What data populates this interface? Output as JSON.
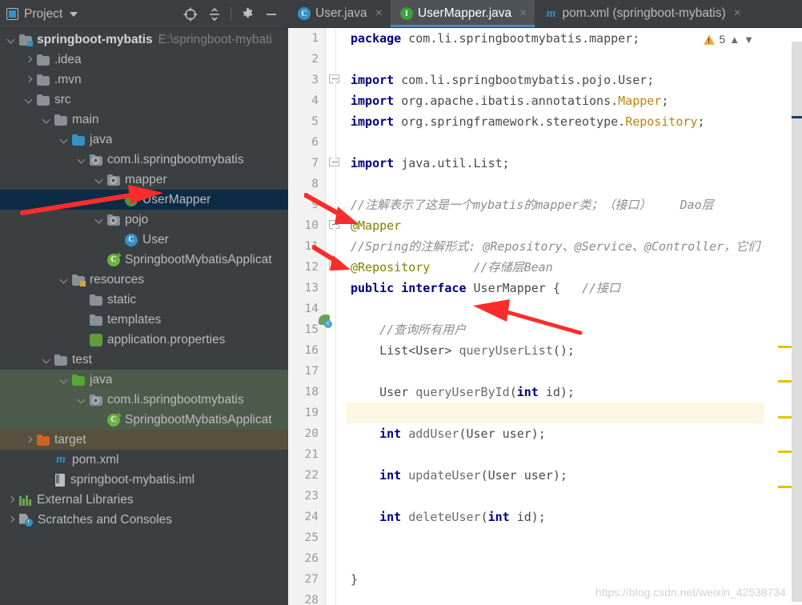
{
  "tool_window": {
    "title": "Project",
    "dropdown_icon": "chevron-down-icon",
    "actions": [
      {
        "name": "select-opened-file-icon",
        "label": "Select Opened File"
      },
      {
        "name": "collapse-all-icon",
        "label": "Collapse All"
      },
      {
        "name": "settings-gear-icon",
        "label": "Settings"
      },
      {
        "name": "hide-icon",
        "label": "Hide"
      }
    ]
  },
  "tree": [
    {
      "label": "springboot-mybatis",
      "path": "E:\\springboot-mybati",
      "icon": "module-folder-icon",
      "indent": 0,
      "arrow": "down",
      "bold": true,
      "state": "normal"
    },
    {
      "label": ".idea",
      "path": "",
      "icon": "folder-icon",
      "indent": 1,
      "arrow": "right",
      "bold": false,
      "state": "normal"
    },
    {
      "label": ".mvn",
      "path": "",
      "icon": "folder-icon",
      "indent": 1,
      "arrow": "right",
      "bold": false,
      "state": "normal"
    },
    {
      "label": "src",
      "path": "",
      "icon": "folder-icon",
      "indent": 1,
      "arrow": "down",
      "bold": false,
      "state": "normal"
    },
    {
      "label": "main",
      "path": "",
      "icon": "folder-icon",
      "indent": 2,
      "arrow": "down",
      "bold": false,
      "state": "normal"
    },
    {
      "label": "java",
      "path": "",
      "icon": "source-root-folder-icon",
      "indent": 3,
      "arrow": "down",
      "bold": false,
      "state": "normal"
    },
    {
      "label": "com.li.springbootmybatis",
      "path": "",
      "icon": "package-icon",
      "indent": 4,
      "arrow": "down",
      "bold": false,
      "state": "normal"
    },
    {
      "label": "mapper",
      "path": "",
      "icon": "package-icon",
      "indent": 5,
      "arrow": "down",
      "bold": false,
      "state": "normal"
    },
    {
      "label": "UserMapper",
      "path": "",
      "icon": "interface-icon",
      "indent": 6,
      "arrow": "none",
      "bold": false,
      "state": "selected"
    },
    {
      "label": "pojo",
      "path": "",
      "icon": "package-icon",
      "indent": 5,
      "arrow": "down",
      "bold": false,
      "state": "normal"
    },
    {
      "label": "User",
      "path": "",
      "icon": "class-icon",
      "indent": 6,
      "arrow": "none",
      "bold": false,
      "state": "normal"
    },
    {
      "label": "SpringbootMybatisApplicat",
      "path": "",
      "icon": "spring-boot-class-icon",
      "indent": 5,
      "arrow": "none",
      "bold": false,
      "state": "normal"
    },
    {
      "label": "resources",
      "path": "",
      "icon": "resources-root-folder-icon",
      "indent": 3,
      "arrow": "down",
      "bold": false,
      "state": "normal"
    },
    {
      "label": "static",
      "path": "",
      "icon": "folder-icon",
      "indent": 4,
      "arrow": "none",
      "bold": false,
      "state": "normal"
    },
    {
      "label": "templates",
      "path": "",
      "icon": "folder-icon",
      "indent": 4,
      "arrow": "none",
      "bold": false,
      "state": "normal"
    },
    {
      "label": "application.properties",
      "path": "",
      "icon": "spring-properties-icon",
      "indent": 4,
      "arrow": "none",
      "bold": false,
      "state": "normal"
    },
    {
      "label": "test",
      "path": "",
      "icon": "folder-icon",
      "indent": 2,
      "arrow": "down",
      "bold": false,
      "state": "normal"
    },
    {
      "label": "java",
      "path": "",
      "icon": "test-source-root-folder-icon",
      "indent": 3,
      "arrow": "down",
      "bold": false,
      "state": "test-scope"
    },
    {
      "label": "com.li.springbootmybatis",
      "path": "",
      "icon": "package-icon",
      "indent": 4,
      "arrow": "down",
      "bold": false,
      "state": "test-scope"
    },
    {
      "label": "SpringbootMybatisApplicat",
      "path": "",
      "icon": "spring-boot-class-icon",
      "indent": 5,
      "arrow": "none",
      "bold": false,
      "state": "test-scope"
    },
    {
      "label": "target",
      "path": "",
      "icon": "excluded-folder-icon",
      "indent": 1,
      "arrow": "right",
      "bold": false,
      "state": "excluded"
    },
    {
      "label": "pom.xml",
      "path": "",
      "icon": "maven-icon",
      "indent": 2,
      "arrow": "none",
      "bold": false,
      "state": "normal"
    },
    {
      "label": "springboot-mybatis.iml",
      "path": "",
      "icon": "iml-module-icon",
      "indent": 2,
      "arrow": "none",
      "bold": false,
      "state": "normal"
    },
    {
      "label": "External Libraries",
      "path": "",
      "icon": "libraries-icon",
      "indent": 0,
      "arrow": "right",
      "bold": false,
      "state": "normal"
    },
    {
      "label": "Scratches and Consoles",
      "path": "",
      "icon": "scratches-icon",
      "indent": 0,
      "arrow": "right",
      "bold": false,
      "state": "normal"
    }
  ],
  "tabs": [
    {
      "label": "User.java",
      "icon": "class-icon",
      "active": false,
      "close_icon": "close-icon"
    },
    {
      "label": "UserMapper.java",
      "icon": "interface-icon",
      "active": true,
      "close_icon": "close-icon"
    },
    {
      "label": "pom.xml (springboot-mybatis)",
      "icon": "maven-icon",
      "active": false,
      "close_icon": "close-icon"
    }
  ],
  "inspection": {
    "warning_icon": "warning-triangle-icon",
    "warning_count": "5",
    "prev_icon": "chevron-up-icon",
    "next_icon": "chevron-down-icon"
  },
  "code": {
    "language": "Java",
    "highlighted_line": 19,
    "total_visible_lines": 28,
    "lines": [
      {
        "n": 1,
        "tokens": [
          {
            "t": "package ",
            "c": "kw"
          },
          {
            "t": "com.li.springbootmybatis.mapper;",
            "c": "plain"
          }
        ]
      },
      {
        "n": 2,
        "tokens": []
      },
      {
        "n": 3,
        "tokens": [
          {
            "t": "import ",
            "c": "kw"
          },
          {
            "t": "com.li.springbootmybatis.pojo.User;",
            "c": "plain"
          }
        ]
      },
      {
        "n": 4,
        "tokens": [
          {
            "t": "import ",
            "c": "kw"
          },
          {
            "t": "org.apache.ibatis.annotations.",
            "c": "plain"
          },
          {
            "t": "Mapper",
            "c": "annref"
          },
          {
            "t": ";",
            "c": "plain"
          }
        ]
      },
      {
        "n": 5,
        "tokens": [
          {
            "t": "import ",
            "c": "kw"
          },
          {
            "t": "org.springframework.stereotype.",
            "c": "plain"
          },
          {
            "t": "Repository",
            "c": "annref"
          },
          {
            "t": ";",
            "c": "plain"
          }
        ]
      },
      {
        "n": 6,
        "tokens": []
      },
      {
        "n": 7,
        "tokens": [
          {
            "t": "import ",
            "c": "kw"
          },
          {
            "t": "java.util.List;",
            "c": "plain"
          }
        ]
      },
      {
        "n": 8,
        "tokens": []
      },
      {
        "n": 9,
        "tokens": [
          {
            "t": "//注解表示了这是一个mybatis的mapper类；（接口）    Dao层",
            "c": "cmt"
          }
        ]
      },
      {
        "n": 10,
        "tokens": [
          {
            "t": "@Mapper",
            "c": "anno"
          }
        ]
      },
      {
        "n": 11,
        "tokens": [
          {
            "t": "//Spring的注解形式: @Repository、@Service、@Controller，它们",
            "c": "cmt"
          }
        ]
      },
      {
        "n": 12,
        "tokens": [
          {
            "t": "@Repository",
            "c": "anno"
          },
          {
            "t": "      ",
            "c": "plain"
          },
          {
            "t": "//存储层Bean",
            "c": "cmt"
          }
        ]
      },
      {
        "n": 13,
        "tokens": [
          {
            "t": "public interface ",
            "c": "kw"
          },
          {
            "t": "UserMapper",
            "c": "plain"
          },
          {
            "t": " {   ",
            "c": "plain"
          },
          {
            "t": "//接口",
            "c": "cmt"
          }
        ]
      },
      {
        "n": 14,
        "tokens": []
      },
      {
        "n": 15,
        "tokens": [
          {
            "t": "    //查询所有用户",
            "c": "cmt"
          }
        ]
      },
      {
        "n": 16,
        "tokens": [
          {
            "t": "    ",
            "c": "plain"
          },
          {
            "t": "List<User>",
            "c": "plain"
          },
          {
            "t": " ",
            "c": "plain"
          },
          {
            "t": "queryUserList",
            "c": "ident"
          },
          {
            "t": "();",
            "c": "plain"
          }
        ]
      },
      {
        "n": 17,
        "tokens": []
      },
      {
        "n": 18,
        "tokens": [
          {
            "t": "    ",
            "c": "plain"
          },
          {
            "t": "User",
            "c": "plain"
          },
          {
            "t": " ",
            "c": "plain"
          },
          {
            "t": "queryUserById",
            "c": "ident"
          },
          {
            "t": "(",
            "c": "plain"
          },
          {
            "t": "int",
            "c": "kw"
          },
          {
            "t": " id);",
            "c": "plain"
          }
        ]
      },
      {
        "n": 19,
        "tokens": []
      },
      {
        "n": 20,
        "tokens": [
          {
            "t": "    ",
            "c": "plain"
          },
          {
            "t": "int",
            "c": "kw"
          },
          {
            "t": " ",
            "c": "plain"
          },
          {
            "t": "addUser",
            "c": "ident"
          },
          {
            "t": "(User user);",
            "c": "plain"
          }
        ]
      },
      {
        "n": 21,
        "tokens": []
      },
      {
        "n": 22,
        "tokens": [
          {
            "t": "    ",
            "c": "plain"
          },
          {
            "t": "int",
            "c": "kw"
          },
          {
            "t": " ",
            "c": "plain"
          },
          {
            "t": "updateUser",
            "c": "ident"
          },
          {
            "t": "(User user);",
            "c": "plain"
          }
        ]
      },
      {
        "n": 23,
        "tokens": []
      },
      {
        "n": 24,
        "tokens": [
          {
            "t": "    ",
            "c": "plain"
          },
          {
            "t": "int",
            "c": "kw"
          },
          {
            "t": " ",
            "c": "plain"
          },
          {
            "t": "deleteUser",
            "c": "ident"
          },
          {
            "t": "(",
            "c": "plain"
          },
          {
            "t": "int",
            "c": "kw"
          },
          {
            "t": " id);",
            "c": "plain"
          }
        ]
      },
      {
        "n": 25,
        "tokens": []
      },
      {
        "n": 26,
        "tokens": []
      },
      {
        "n": 27,
        "tokens": [
          {
            "t": "}",
            "c": "plain"
          }
        ]
      },
      {
        "n": 28,
        "tokens": []
      }
    ]
  },
  "watermark": "https://blog.csdn.net/weixin_42538734",
  "annotations": {
    "arrow_color": "#fb2c2c",
    "arrows": [
      {
        "name": "arrow-to-usermapper-tree-node"
      },
      {
        "name": "arrow-to-mapper-annotation"
      },
      {
        "name": "arrow-to-repository-annotation"
      },
      {
        "name": "arrow-to-interface-body"
      }
    ]
  },
  "colors": {
    "ide_chrome": "#3c3f41",
    "editor_bg": "#ffffff",
    "tab_active_bg": "#4e5254",
    "tab_underline": "#4a88c7",
    "tree_selection": "#0d2b44",
    "test_scope": "#4c5b4c",
    "excluded": "#56503c",
    "caret_line": "#fdf6e3",
    "warning_marker": "#e5c100"
  }
}
